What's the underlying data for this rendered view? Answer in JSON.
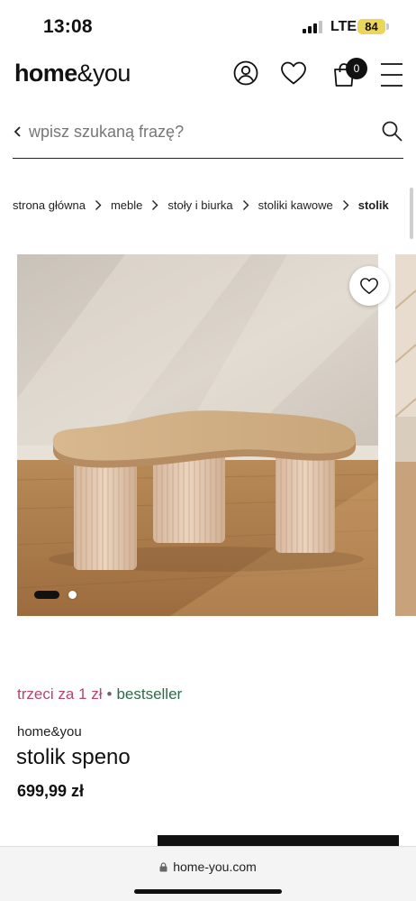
{
  "status_bar": {
    "time": "13:08",
    "network": "LTE",
    "battery": "84"
  },
  "header": {
    "logo_bold": "home",
    "logo_light": "&you",
    "cart_count": "0"
  },
  "search": {
    "placeholder": "wpisz szukaną frazę?"
  },
  "breadcrumb": [
    "strona główna",
    "meble",
    "stoły i biurka",
    "stoliki kawowe",
    "stolik"
  ],
  "gallery": {
    "image_count": 2,
    "active_index": 1
  },
  "product": {
    "promo_tag": "trzeci za 1 zł",
    "separator": "•",
    "badge": "bestseller",
    "brand": "home&you",
    "name": "stolik speno",
    "price": "699,99 zł"
  },
  "browser": {
    "url": "home-you.com"
  },
  "colors": {
    "promo": "#b5456b",
    "bestseller": "#2e6b4a",
    "battery": "#ecd65a"
  },
  "icons": [
    "user-icon",
    "heart-icon",
    "cart-icon",
    "menu-icon",
    "search-icon",
    "back-chevron-icon",
    "lock-icon"
  ]
}
